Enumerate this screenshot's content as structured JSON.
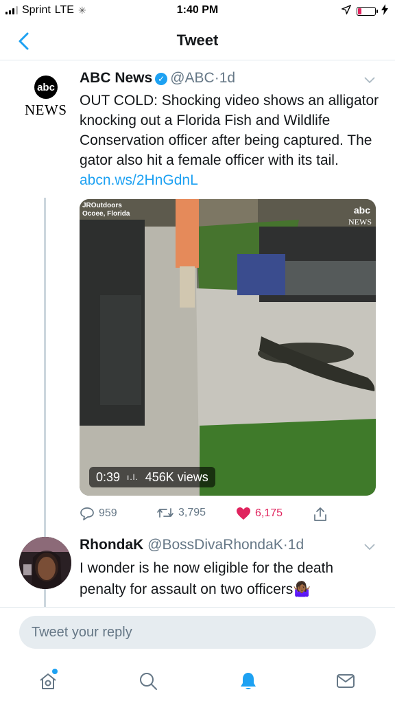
{
  "status_bar": {
    "carrier": "Sprint",
    "network": "LTE",
    "time": "1:40 PM",
    "battery_level": 0.2,
    "colors": {
      "battery_low": "#e0245e"
    }
  },
  "nav": {
    "title": "Tweet",
    "back_icon": "chevron-left-icon"
  },
  "tweet": {
    "author_name": "ABC News",
    "handle": "@ABC",
    "separator": "·",
    "time": "1d",
    "avatar_logo": "abc",
    "avatar_caption": "NEWS",
    "text": "OUT COLD: Shocking video shows an alligator knocking out a Florida Fish and Wildlife Conservation officer after being captured. The gator also hit a female officer with its tail.",
    "link": "abcn.ws/2HnGdnL",
    "media": {
      "source_line1": "JROutdoors",
      "source_line2": "Ocoee, Florida",
      "watermark_logo": "abc",
      "watermark_text": "NEWS",
      "duration": "0:39",
      "views": "456K views"
    },
    "stats": {
      "replies": "959",
      "retweets": "3,795",
      "likes": "6,175"
    }
  },
  "reply": {
    "author_name": "RhondaK",
    "handle": "@BossDivaRhondaK",
    "separator": "·",
    "time": "1d",
    "text": "I wonder is he now eligible for the death penalty for assault on two officers🤷🏾‍♀️"
  },
  "composer": {
    "placeholder": "Tweet your reply"
  },
  "tab_bar": {
    "items": [
      "home-icon",
      "search-icon",
      "bell-icon",
      "envelope-icon"
    ],
    "active": "bell-icon"
  },
  "colors": {
    "accent": "#1da1f2",
    "like": "#e0245e",
    "muted": "#657786"
  }
}
